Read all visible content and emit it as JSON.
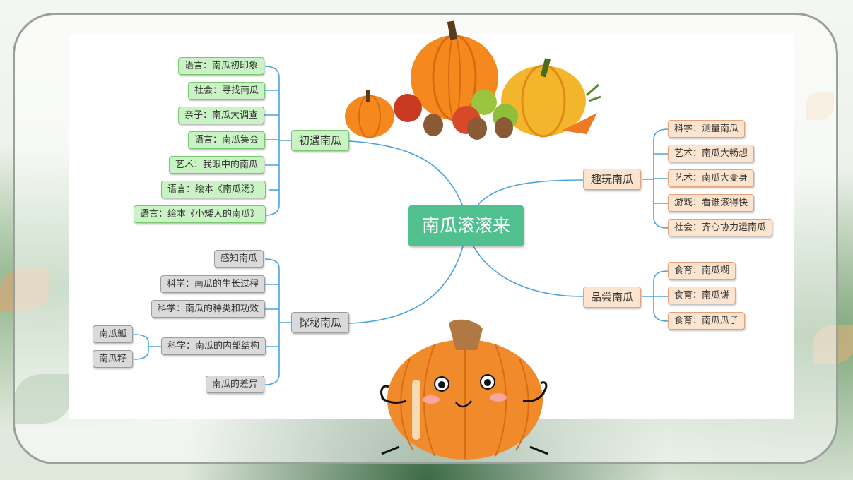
{
  "mindmap": {
    "root": "南瓜滚滚来",
    "branches": {
      "b1": {
        "label": "初遇南瓜",
        "items": [
          "语言：南瓜初印象",
          "社会：寻找南瓜",
          "亲子：南瓜大调查",
          "语言：南瓜集会",
          "艺术：我眼中的南瓜",
          "语言：绘本《南瓜汤》",
          "语言：绘本《小矮人的南瓜》"
        ]
      },
      "b2": {
        "label": "探秘南瓜",
        "items": [
          "感知南瓜",
          "科学：南瓜的生长过程",
          "科学：南瓜的种类和功效",
          "科学：南瓜的内部结构",
          "南瓜的差异"
        ],
        "sub": [
          "南瓜瓤",
          "南瓜籽"
        ]
      },
      "b3": {
        "label": "趣玩南瓜",
        "items": [
          "科学：测量南瓜",
          "艺术：南瓜大畅想",
          "艺术：南瓜大变身",
          "游戏：看谁滚得快",
          "社会：齐心协力运南瓜"
        ]
      },
      "b4": {
        "label": "品尝南瓜",
        "items": [
          "食育：南瓜糊",
          "食育：南瓜饼",
          "食育：南瓜瓜子"
        ]
      }
    }
  },
  "colors": {
    "line": "#4aa3e0",
    "root": "#4fc08e",
    "green": "#c9f3c4",
    "orange": "#fde4cf",
    "gray": "#dadada",
    "pumpkin": "#f08a2a"
  },
  "decor": {
    "illustrations": [
      "pumpkin-fruit-pile-illustration",
      "cartoon-pumpkin-character"
    ]
  }
}
